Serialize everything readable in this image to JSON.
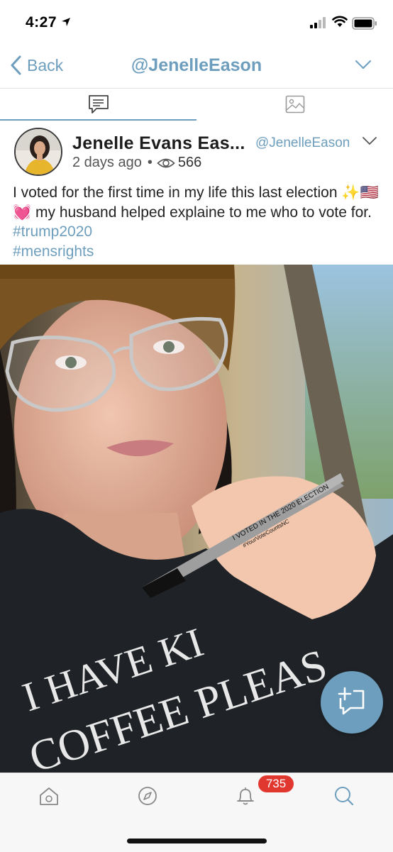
{
  "status_bar": {
    "time": "4:27"
  },
  "nav": {
    "back_label": "Back",
    "title": "@JenelleEason"
  },
  "tabs": [
    {
      "name": "posts",
      "icon": "comment-icon",
      "active": true
    },
    {
      "name": "media",
      "icon": "image-icon",
      "active": false
    }
  ],
  "post": {
    "author_name": "Jenelle Evans Eas...",
    "handle": "@JenelleEason",
    "time_ago": "2 days ago",
    "dot": "•",
    "views": "566",
    "text_part1": "I voted for the first time in my life this last election ",
    "emojis": "✨🇺🇸💓",
    "text_part2": " my husband helped explaine to me who to vote for. ",
    "hashtag1": "#trump2020",
    "hashtag2": "#mensrights"
  },
  "photo": {
    "pen_text_line1": "I VOTED IN THE 2020 ELECTION",
    "pen_text_line2": "#YourVoteCountsNC",
    "shirt_text_line1": "I HAVE KI",
    "shirt_text_line2": "COFFEE PLEAS"
  },
  "bottom_bar": {
    "notifications_badge": "735"
  },
  "colors": {
    "accent": "#6d9ebd",
    "badge": "#e0372f"
  }
}
